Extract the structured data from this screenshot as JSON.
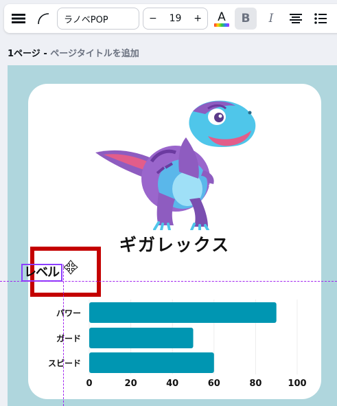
{
  "toolbar": {
    "font_name": "ラノベPOP",
    "size_minus": "−",
    "font_size": "19",
    "size_plus": "+",
    "text_color_label": "A",
    "bold_label": "B",
    "italic_label": "I"
  },
  "page": {
    "label": "1ページ",
    "separator": " - ",
    "title_placeholder": "ページタイトルを追加"
  },
  "card": {
    "title": "ギガレックス",
    "section_label": "レベル"
  },
  "colors": {
    "canvas_bg": "#afd6dd",
    "bar": "#0096b2",
    "selection": "#8b3dff",
    "highlight": "#c40000"
  },
  "chart_data": {
    "type": "bar",
    "orientation": "horizontal",
    "categories": [
      "パワー",
      "ガード",
      "スピード"
    ],
    "values": [
      90,
      50,
      60
    ],
    "xlim": [
      0,
      100
    ],
    "xticks": [
      "0",
      "20",
      "40",
      "60",
      "80",
      "100"
    ],
    "grid": true
  }
}
